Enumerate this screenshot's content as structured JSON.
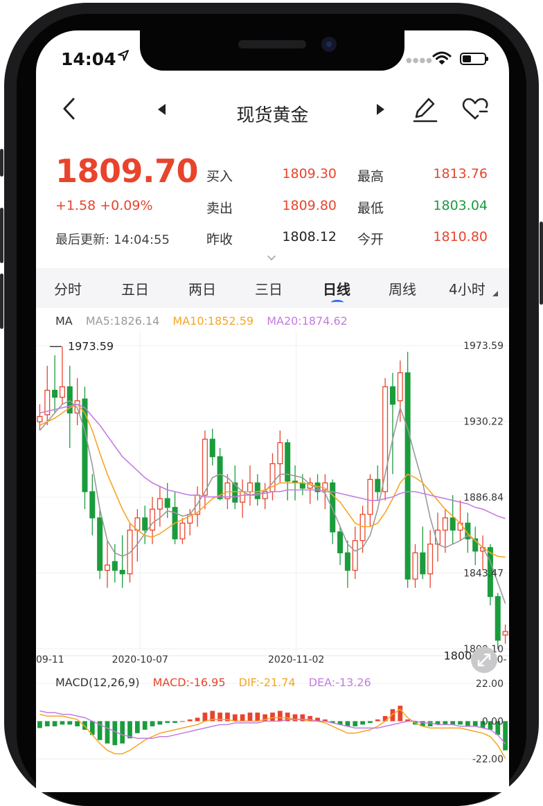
{
  "status_bar": {
    "time": "14:04",
    "location_icon": "location-arrow-icon",
    "wifi_icon": "wifi-icon",
    "battery_icon": "battery-icon"
  },
  "nav": {
    "title": "现货黄金",
    "back_icon": "chevron-left-icon",
    "prev_icon": "triangle-left-icon",
    "next_icon": "triangle-right-icon",
    "edit_icon": "pencil-icon",
    "favorite_icon": "heart-add-icon"
  },
  "quote": {
    "price": "1809.70",
    "change": "+1.58 +0.09%",
    "updated_label": "最后更新:",
    "updated_time": "14:04:55",
    "buy_label": "买入",
    "buy_value": "1809.30",
    "sell_label": "卖出",
    "sell_value": "1809.80",
    "prev_close_label": "昨收",
    "prev_close_value": "1808.12",
    "high_label": "最高",
    "high_value": "1813.76",
    "low_label": "最低",
    "low_value": "1803.04",
    "open_label": "今开",
    "open_value": "1810.80"
  },
  "tabs": [
    {
      "label": "分时"
    },
    {
      "label": "五日"
    },
    {
      "label": "两日"
    },
    {
      "label": "三日"
    },
    {
      "label": "日线",
      "active": true
    },
    {
      "label": "周线"
    },
    {
      "label": "4小时"
    }
  ],
  "colors": {
    "up": "#e8442c",
    "down": "#1a9c3d",
    "ma5": "#9a9a9a",
    "ma10": "#f5a623",
    "ma20": "#c47be0"
  },
  "ma_legend": {
    "name": "MA",
    "ma5": "MA5:1826.14",
    "ma10": "MA10:1852.59",
    "ma20": "MA20:1874.62"
  },
  "macd_legend": {
    "name": "MACD(12,26,9)",
    "macd": "MACD:-16.95",
    "dif": "DIF:-21.74",
    "dea": "DEA:-13.26"
  },
  "chart_data": [
    {
      "type": "candlestick",
      "y_ticks": [
        "1973.59",
        "1930.22",
        "1886.84",
        "1843.47",
        "1800.10"
      ],
      "ylim": [
        1800.1,
        1973.59
      ],
      "x_ticks": [
        "09-11",
        "2020-10-07",
        "2020-11-02",
        "2020-"
      ],
      "max_label": "1973.59",
      "min_label": "1800.10",
      "ohlc": [
        [
          1930,
          1940,
          1925,
          1933
        ],
        [
          1934,
          1962,
          1928,
          1948
        ],
        [
          1948,
          1968,
          1935,
          1944
        ],
        [
          1944,
          1973,
          1940,
          1950
        ],
        [
          1950,
          1962,
          1915,
          1935
        ],
        [
          1935,
          1955,
          1928,
          1942
        ],
        [
          1943,
          1950,
          1880,
          1890
        ],
        [
          1890,
          1900,
          1865,
          1875
        ],
        [
          1875,
          1880,
          1840,
          1845
        ],
        [
          1845,
          1862,
          1835,
          1848
        ],
        [
          1850,
          1860,
          1838,
          1845
        ],
        [
          1845,
          1865,
          1835,
          1843
        ],
        [
          1843,
          1872,
          1838,
          1868
        ],
        [
          1868,
          1880,
          1850,
          1875
        ],
        [
          1875,
          1882,
          1860,
          1868
        ],
        [
          1868,
          1887,
          1860,
          1880
        ],
        [
          1880,
          1893,
          1870,
          1886
        ],
        [
          1886,
          1895,
          1875,
          1881
        ],
        [
          1881,
          1890,
          1860,
          1863
        ],
        [
          1863,
          1875,
          1860,
          1872
        ],
        [
          1872,
          1880,
          1865,
          1877
        ],
        [
          1877,
          1893,
          1870,
          1888
        ],
        [
          1888,
          1925,
          1880,
          1920
        ],
        [
          1920,
          1926,
          1905,
          1910
        ],
        [
          1910,
          1915,
          1885,
          1886
        ],
        [
          1886,
          1900,
          1880,
          1895
        ],
        [
          1895,
          1905,
          1880,
          1884
        ],
        [
          1884,
          1897,
          1875,
          1890
        ],
        [
          1890,
          1905,
          1882,
          1895
        ],
        [
          1895,
          1900,
          1882,
          1886
        ],
        [
          1886,
          1895,
          1880,
          1890
        ],
        [
          1890,
          1912,
          1885,
          1906
        ],
        [
          1906,
          1925,
          1895,
          1918
        ],
        [
          1918,
          1920,
          1885,
          1896
        ],
        [
          1896,
          1905,
          1885,
          1895
        ],
        [
          1895,
          1900,
          1888,
          1892
        ],
        [
          1892,
          1898,
          1883,
          1895
        ],
        [
          1895,
          1900,
          1885,
          1890
        ],
        [
          1891,
          1900,
          1880,
          1895
        ],
        [
          1895,
          1897,
          1860,
          1867
        ],
        [
          1867,
          1870,
          1848,
          1855
        ],
        [
          1855,
          1862,
          1835,
          1845
        ],
        [
          1845,
          1870,
          1840,
          1862
        ],
        [
          1862,
          1882,
          1855,
          1877
        ],
        [
          1877,
          1900,
          1870,
          1897
        ],
        [
          1897,
          1905,
          1885,
          1890
        ],
        [
          1890,
          1955,
          1885,
          1950
        ],
        [
          1950,
          1958,
          1900,
          1940
        ],
        [
          1942,
          1965,
          1930,
          1958
        ],
        [
          1958,
          1970,
          1835,
          1840
        ],
        [
          1840,
          1860,
          1835,
          1855
        ],
        [
          1855,
          1870,
          1840,
          1843
        ],
        [
          1843,
          1868,
          1835,
          1860
        ],
        [
          1860,
          1878,
          1850,
          1868
        ],
        [
          1868,
          1880,
          1855,
          1875
        ],
        [
          1875,
          1888,
          1860,
          1868
        ],
        [
          1868,
          1885,
          1862,
          1872
        ],
        [
          1872,
          1878,
          1855,
          1863
        ],
        [
          1863,
          1870,
          1848,
          1856
        ],
        [
          1856,
          1865,
          1845,
          1858
        ],
        [
          1858,
          1860,
          1825,
          1830
        ],
        [
          1830,
          1832,
          1800,
          1805
        ],
        [
          1808,
          1814,
          1803,
          1810
        ]
      ],
      "ma5": [
        1925,
        1930,
        1935,
        1940,
        1942,
        1938,
        1925,
        1905,
        1880,
        1862,
        1855,
        1853,
        1855,
        1860,
        1866,
        1872,
        1875,
        1879,
        1878,
        1876,
        1877,
        1883,
        1890,
        1898,
        1900,
        1898,
        1894,
        1890,
        1888,
        1888,
        1890,
        1895,
        1900,
        1900,
        1899,
        1898,
        1894,
        1892,
        1889,
        1880,
        1870,
        1860,
        1856,
        1858,
        1865,
        1880,
        1900,
        1920,
        1938,
        1926,
        1910,
        1895,
        1875,
        1860,
        1858,
        1860,
        1862,
        1865,
        1862,
        1858,
        1850,
        1838,
        1826
      ],
      "ma10": [
        1928,
        1930,
        1932,
        1935,
        1938,
        1940,
        1935,
        1925,
        1912,
        1900,
        1890,
        1880,
        1872,
        1868,
        1865,
        1864,
        1866,
        1869,
        1872,
        1874,
        1876,
        1878,
        1882,
        1886,
        1888,
        1890,
        1890,
        1890,
        1890,
        1890,
        1891,
        1893,
        1895,
        1895,
        1895,
        1895,
        1894,
        1893,
        1892,
        1888,
        1884,
        1878,
        1872,
        1870,
        1870,
        1872,
        1878,
        1886,
        1895,
        1900,
        1898,
        1895,
        1890,
        1885,
        1880,
        1876,
        1872,
        1866,
        1862,
        1858,
        1855,
        1853,
        1852.6
      ],
      "ma20": [
        1935,
        1936,
        1937,
        1938,
        1939,
        1940,
        1938,
        1933,
        1928,
        1922,
        1916,
        1910,
        1906,
        1902,
        1898,
        1895,
        1893,
        1891,
        1890,
        1889,
        1888,
        1888,
        1887,
        1887,
        1887,
        1887,
        1887,
        1888,
        1888,
        1889,
        1889,
        1890,
        1890,
        1891,
        1891,
        1891,
        1891,
        1891,
        1890,
        1890,
        1889,
        1888,
        1887,
        1886,
        1885,
        1885,
        1886,
        1887,
        1889,
        1890,
        1890,
        1889,
        1888,
        1887,
        1886,
        1885,
        1884,
        1883,
        1881,
        1880,
        1878,
        1876,
        1874.6
      ]
    },
    {
      "type": "bar",
      "y_ticks": [
        "22.00",
        "0.00",
        "-22.00"
      ],
      "ylim": [
        -22,
        22
      ],
      "macd": [
        -4,
        -3,
        -3,
        -2,
        -2,
        -3,
        -5,
        -8,
        -11,
        -13,
        -14,
        -13,
        -10,
        -7,
        -5,
        -3,
        -2,
        -1,
        -1,
        0,
        1,
        2,
        5,
        6,
        5,
        5,
        4,
        4,
        5,
        5,
        4,
        5,
        6,
        5,
        4,
        4,
        3,
        2,
        1,
        -1,
        -2,
        -3,
        -3,
        -2,
        -1,
        1,
        3,
        7,
        9,
        1,
        -2,
        -3,
        -3,
        -2,
        -2,
        -2,
        -2,
        -3,
        -3,
        -4,
        -5,
        -8,
        -17
      ],
      "dif": [
        4,
        3,
        3,
        3,
        2,
        1,
        -3,
        -8,
        -13,
        -17,
        -19,
        -19,
        -17,
        -14,
        -11,
        -9,
        -7,
        -6,
        -5,
        -4,
        -3,
        -2,
        0,
        1,
        1,
        1,
        0,
        0,
        0,
        0,
        1,
        2,
        2,
        2,
        1,
        1,
        0,
        0,
        -1,
        -3,
        -5,
        -7,
        -7,
        -6,
        -5,
        -3,
        0,
        4,
        7,
        2,
        -1,
        -3,
        -4,
        -4,
        -4,
        -4,
        -4,
        -5,
        -6,
        -7,
        -9,
        -14,
        -21.7
      ],
      "dea": [
        6,
        5,
        5,
        4,
        4,
        3,
        2,
        0,
        -2,
        -4,
        -6,
        -8,
        -9,
        -10,
        -10,
        -10,
        -9,
        -9,
        -8,
        -7,
        -6,
        -5,
        -4,
        -3,
        -2,
        -2,
        -1,
        -1,
        -1,
        -1,
        0,
        0,
        0,
        1,
        1,
        1,
        1,
        0,
        0,
        -1,
        -2,
        -3,
        -4,
        -4,
        -4,
        -4,
        -3,
        -2,
        -1,
        0,
        0,
        -1,
        -1,
        -2,
        -2,
        -2,
        -3,
        -3,
        -3,
        -4,
        -5,
        -8,
        -13.3
      ]
    }
  ]
}
